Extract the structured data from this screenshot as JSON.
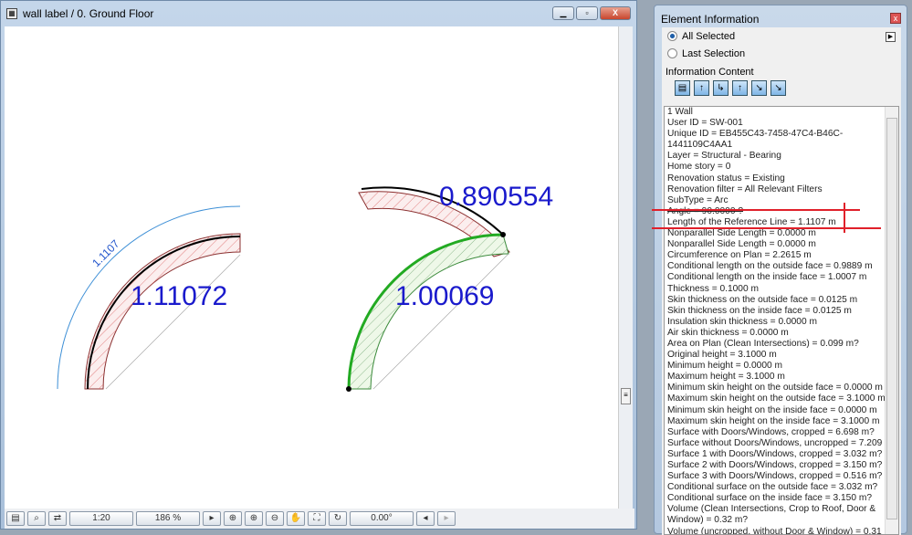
{
  "window": {
    "title": "wall label / 0. Ground Floor",
    "min": "▁",
    "max": "▫",
    "close": "X"
  },
  "drawing": {
    "dimension_label": "1.1107",
    "left_wall_label": "1.11072",
    "top_wall_label": "0.890554",
    "green_wall_label": "1.00069",
    "colors": {
      "label": "#1a1acc",
      "selected": "#22aa22",
      "hatch": "#cc4444",
      "dimension": "#3d8fd6"
    }
  },
  "statusbar": {
    "scale": "1:20",
    "zoom": "186 %",
    "angle": "0.00°"
  },
  "panel": {
    "title": "Element Information",
    "all_selected": "All Selected",
    "last_selection": "Last Selection",
    "info_content": "Information Content",
    "rows": [
      "1 Wall",
      "User ID = SW-001",
      "Unique ID = EB455C43-7458-47C4-B46C-",
      "1441109C4AA1",
      "Layer = Structural - Bearing",
      "Home story = 0",
      "Renovation status = Existing",
      "Renovation filter = All Relevant Filters",
      "SubType = Arc",
      "Angle = 90.0000    ?",
      "Length of the Reference Line = 1.1107 m",
      "Nonparallel Side Length = 0.0000 m",
      "Nonparallel Side Length = 0.0000 m",
      "Circumference on Plan = 2.2615 m",
      "Conditional length on the outside face = 0.9889 m",
      "Conditional length on the inside face = 1.0007 m",
      "Thickness = 0.1000 m",
      "Skin thickness on the outside face = 0.0125 m",
      "Skin thickness on the inside face = 0.0125 m",
      "Insulation skin thickness = 0.0000 m",
      "Air skin thickness = 0.0000 m",
      "Area on Plan (Clean Intersections) = 0.099 m?",
      "Original height = 3.1000 m",
      "Minimum height = 0.0000 m",
      "Maximum height = 3.1000 m",
      "Minimum skin height on the outside face = 0.0000 m",
      "Maximum skin height on the outside face = 3.1000 m",
      "Minimum skin height on the inside face = 0.0000 m",
      "Maximum skin height on the inside face = 3.1000 m",
      "Surface with Doors/Windows, cropped = 6.698 m?",
      "Surface without Doors/Windows, uncropped = 7.209 m?",
      "Surface 1 with Doors/Windows, cropped = 3.032 m?",
      "Surface 2 with Doors/Windows, cropped = 3.150 m?",
      "Surface 3 with Doors/Windows, cropped = 0.516 m?",
      "Conditional surface on the outside face = 3.032 m?",
      "Conditional surface on the inside face = 3.150 m?",
      "Volume (Clean Intersections, Crop to Roof, Door &",
      "Window) = 0.32 m?",
      "Volume (uncropped, without Door & Window) = 0.31"
    ]
  }
}
